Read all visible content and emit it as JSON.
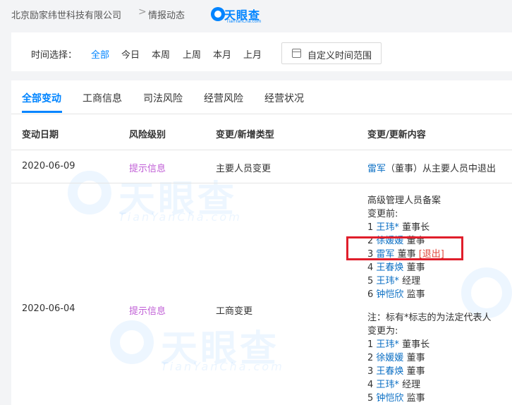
{
  "breadcrumb": {
    "company": "北京励家纬世科技有限公司",
    "separator": ">",
    "current": "情报动态"
  },
  "logo": {
    "name": "天眼查",
    "sub": "TianYanCha.com",
    "color": "#0084ff"
  },
  "filter": {
    "label": "时间选择：",
    "options": [
      "全部",
      "今日",
      "本周",
      "上周",
      "本月",
      "上月"
    ],
    "active_index": 0,
    "custom_label": "自定义时间范围"
  },
  "tabs": {
    "items": [
      "全部变动",
      "工商信息",
      "司法风险",
      "经营风险",
      "经营状况"
    ],
    "active_index": 0
  },
  "table": {
    "headers": [
      "变动日期",
      "风险级别",
      "变更/新增类型",
      "变更/更新内容"
    ],
    "row1": {
      "date": "2020-06-09",
      "risk": "提示信息",
      "type": "主要人员变更",
      "person": "雷军",
      "content_rest": "（董事）从主要人员中退出"
    },
    "row2": {
      "date": "2020-06-04",
      "risk": "提示信息",
      "type": "工商变更",
      "title": "高级管理人员备案",
      "before_label": "变更前:",
      "before": [
        {
          "no": "1",
          "name": "王玮*",
          "role": "董事长"
        },
        {
          "no": "2",
          "name": "徐媛媛",
          "role": "董事"
        },
        {
          "no": "3",
          "name": "雷军",
          "role": "董事",
          "tag": "[退出]"
        },
        {
          "no": "4",
          "name": "王春焕",
          "role": "董事"
        },
        {
          "no": "5",
          "name": "王玮*",
          "role": "经理"
        },
        {
          "no": "6",
          "name": "钟恺欣",
          "role": "监事"
        }
      ],
      "note": "注：标有*标志的为法定代表人",
      "after_label": "变更为:",
      "after": [
        {
          "no": "1",
          "name": "王玮*",
          "role": "董事长"
        },
        {
          "no": "2",
          "name": "徐媛媛",
          "role": "董事"
        },
        {
          "no": "3",
          "name": "王春焕",
          "role": "董事"
        },
        {
          "no": "4",
          "name": "王玮*",
          "role": "经理"
        },
        {
          "no": "5",
          "name": "钟恺欣",
          "role": "监事"
        }
      ]
    }
  },
  "colors": {
    "accent": "#0084ff",
    "risk": "#c05ed6",
    "exit": "#e0483d",
    "highlight": "#e01e2b"
  }
}
